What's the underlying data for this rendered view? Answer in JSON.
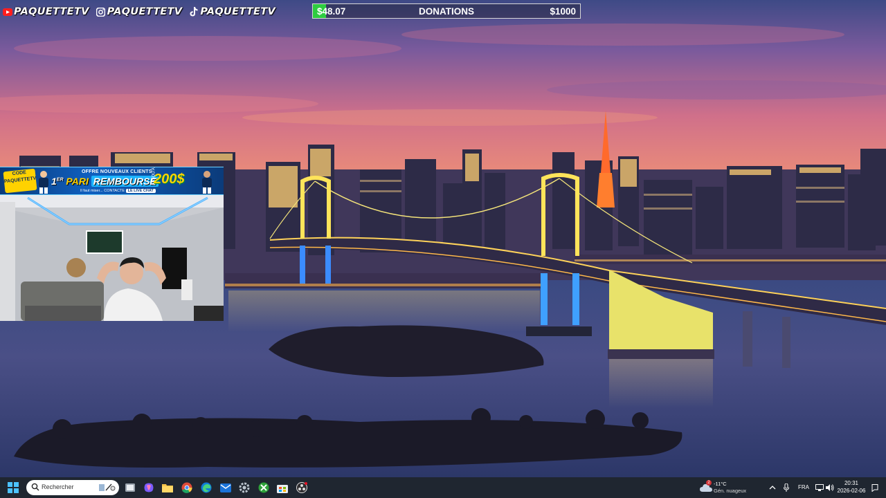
{
  "stream_overlay": {
    "socials": [
      {
        "icon": "youtube-icon",
        "handle": "PAQUETTETV"
      },
      {
        "icon": "instagram-icon",
        "handle": "PAQUETTETV"
      },
      {
        "icon": "tiktok-icon",
        "handle": "PAQUETTETV"
      }
    ],
    "donation": {
      "current": "$48.07",
      "title": "DONATIONS",
      "goal": "$1000",
      "progress_fraction": 0.048,
      "fill_color": "#2ecc40"
    },
    "sponsor": {
      "logo_top": "CODE",
      "logo_main": "PAQUETTETV",
      "offer": "OFFRE NOUVEAUX CLIENTS",
      "headline_prefix": "1",
      "headline_sup": "ER",
      "headline_word": "PARI",
      "headline_box": "REMBOURSE",
      "upto": "JUSQU'À",
      "amount": "200$",
      "fine_print": "Il faut miser... CONTACTE",
      "live_chat": "LE LIVE CHAT"
    }
  },
  "taskbar": {
    "search_placeholder": "Rechercher",
    "apps": [
      "file-explorer-icon",
      "copilot-icon",
      "folder-icon",
      "chrome-icon",
      "edge-icon",
      "mail-icon",
      "settings-icon",
      "xbox-icon",
      "store-icon",
      "obs-icon"
    ],
    "weather": {
      "temperature": "-11°C",
      "condition": "Gén. nuageux",
      "badge": "2"
    },
    "language": "FRA",
    "time": "20:31",
    "date": "2026-02-06"
  }
}
